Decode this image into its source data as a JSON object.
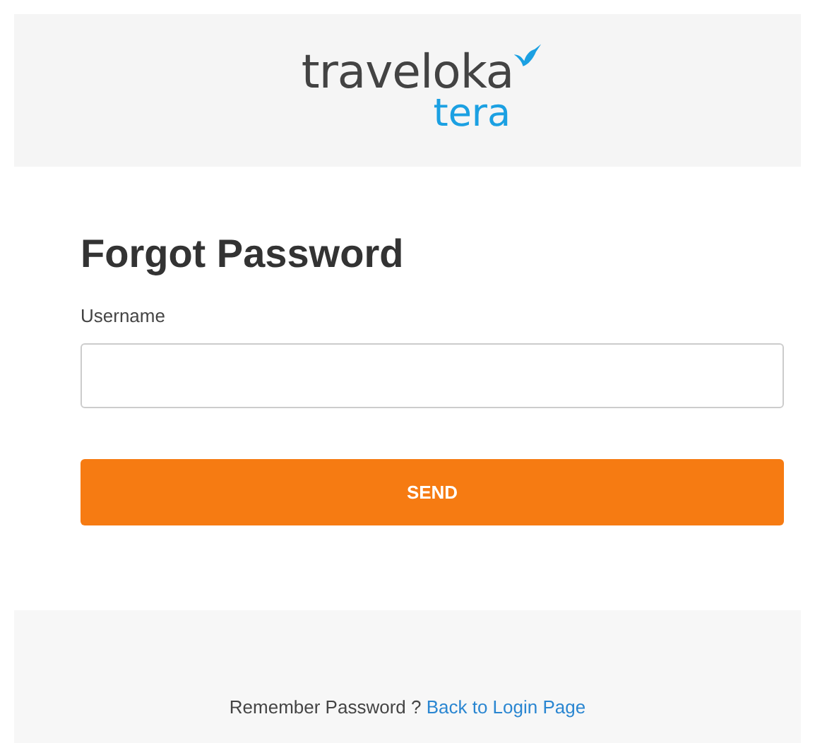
{
  "logo": {
    "brand": "traveloka",
    "product": "tera"
  },
  "form": {
    "title": "Forgot Password",
    "field_label": "Username",
    "button": "SEND"
  },
  "footer": {
    "text": "Remember Password ?",
    "link": "Back to Login Page"
  }
}
